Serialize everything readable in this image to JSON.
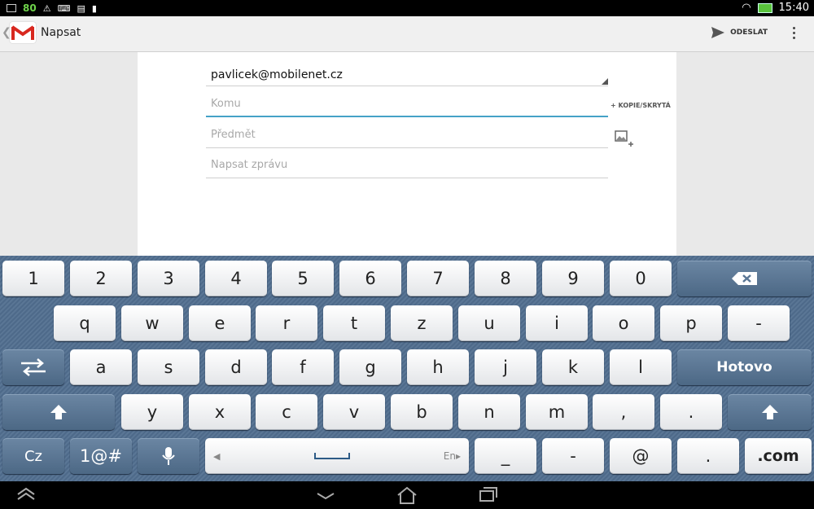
{
  "status_bar": {
    "battery_level": "80",
    "time": "15:40"
  },
  "action_bar": {
    "title": "Napsat",
    "send_label": "ODESLAT"
  },
  "compose": {
    "from": "pavlicek@mobilenet.cz",
    "to_placeholder": "Komu",
    "cc_bcc_label": "+ KOPIE/SKRYTÁ",
    "subject_placeholder": "Předmět",
    "body_placeholder": "Napsat zprávu"
  },
  "keyboard": {
    "row1": [
      "1",
      "2",
      "3",
      "4",
      "5",
      "6",
      "7",
      "8",
      "9",
      "0"
    ],
    "row2": [
      "q",
      "w",
      "e",
      "r",
      "t",
      "z",
      "u",
      "i",
      "o",
      "p",
      "-"
    ],
    "row3": [
      "a",
      "s",
      "d",
      "f",
      "g",
      "h",
      "j",
      "k",
      "l"
    ],
    "done_label": "Hotovo",
    "row4": [
      "y",
      "x",
      "c",
      "v",
      "b",
      "n",
      "m",
      ",",
      "."
    ],
    "row5": {
      "lang": "Cz",
      "symbols": "1@#",
      "space_lang": "En",
      "keys": [
        "_",
        "-",
        "@",
        ".",
        ".com"
      ]
    }
  }
}
